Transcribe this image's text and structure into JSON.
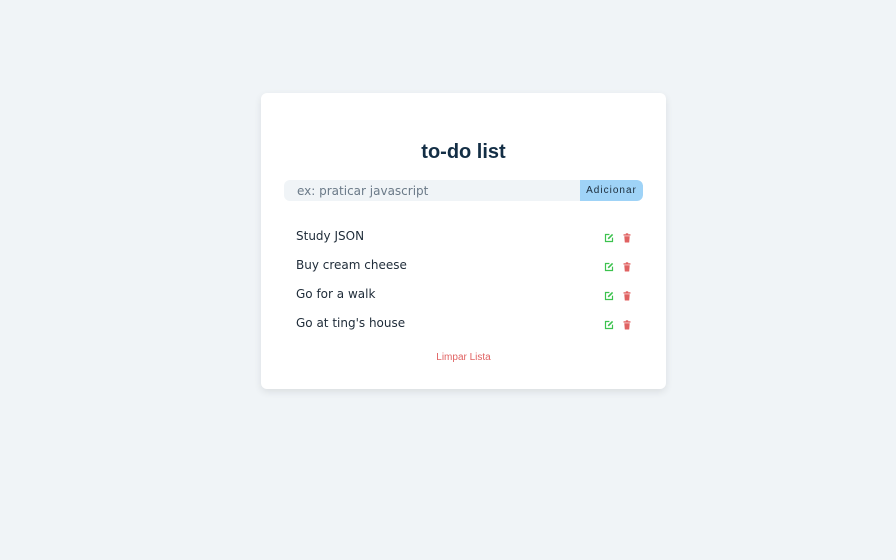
{
  "app": {
    "title": "to-do list"
  },
  "add_form": {
    "placeholder": "ex: praticar javascript",
    "value": "",
    "button_label": "Adicionar"
  },
  "tasks": [
    {
      "text": "Study JSON"
    },
    {
      "text": "Buy cream cheese"
    },
    {
      "text": "Go for a walk"
    },
    {
      "text": "Go at ting's house"
    }
  ],
  "clear_label": "Limpar Lista",
  "colors": {
    "background": "#f0f4f7",
    "card": "#ffffff",
    "title": "#132e45",
    "button": "#9fd3f7",
    "edit_icon": "#3cc24e",
    "delete_icon": "#e06262",
    "clear_link": "#e06262"
  },
  "icons": {
    "edit": "edit-icon",
    "delete": "trash-icon"
  }
}
